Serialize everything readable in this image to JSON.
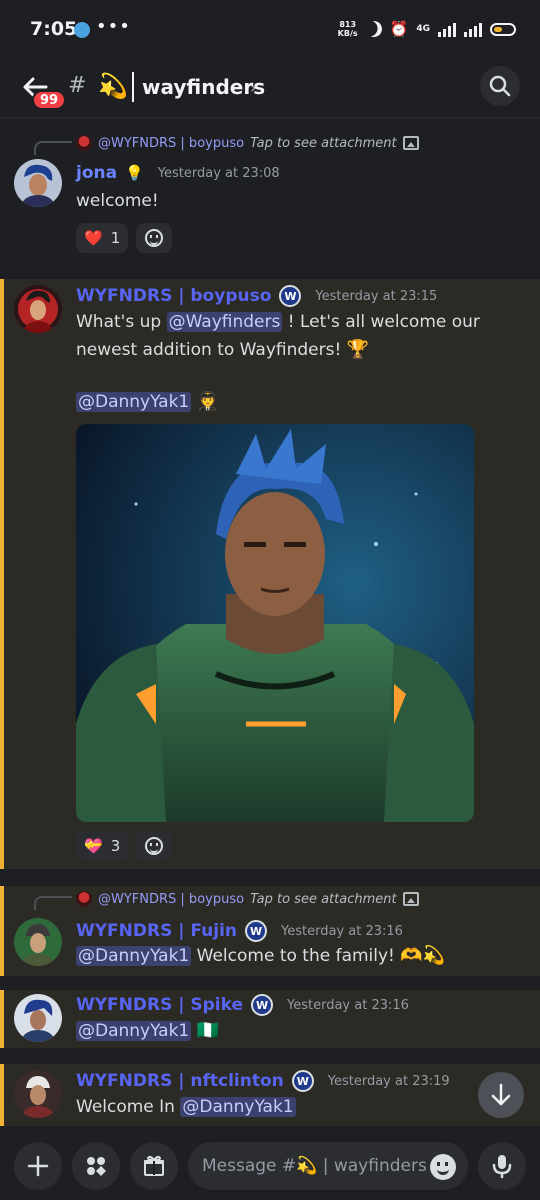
{
  "status_bar": {
    "time": "7:05",
    "dots": "•••",
    "speed_top": "813",
    "speed_bottom": "KB/s",
    "network": "4G"
  },
  "header": {
    "unread_count": "99",
    "hash": "#",
    "channel_emoji": "💫",
    "channel_name": "wayfinders",
    "chevron": "›"
  },
  "messages": [
    {
      "reply_name": "@WYFNDRS | boypuso",
      "reply_text": "Tap to see attachment",
      "author": "jona",
      "role_icon": "💡",
      "timestamp": "Yesterday at 23:08",
      "text": "welcome!",
      "reactions": [
        {
          "emoji": "❤️",
          "count": "1"
        }
      ]
    },
    {
      "author": "WYFNDRS | boypuso",
      "badge": "W",
      "timestamp": "Yesterday at 23:15",
      "text_before": "What's up ",
      "mention1": "@Wayfinders",
      "text_after": " ! Let's all welcome our newest addition to Wayfinders! ",
      "emoji1": "🏆",
      "mention2": "@DannyYak1",
      "emoji2": "🧑‍✈️",
      "reactions": [
        {
          "emoji": "💝",
          "count": "3"
        }
      ]
    },
    {
      "reply_name": "@WYFNDRS | boypuso",
      "reply_text": "Tap to see attachment",
      "author": "WYFNDRS | Fujin",
      "badge": "W",
      "timestamp": "Yesterday at 23:16",
      "mention": "@DannyYak1",
      "text": " Welcome to the family! ",
      "emoji": "🫶💫"
    },
    {
      "author": "WYFNDRS | Spike",
      "badge": "W",
      "timestamp": "Yesterday at 23:16",
      "mention": "@DannyYak1",
      "emoji": "🇳🇬"
    },
    {
      "author": "WYFNDRS | nftclinton",
      "badge": "W",
      "timestamp": "Yesterday at 23:19",
      "text": "Welcome In ",
      "mention": "@DannyYak1"
    }
  ],
  "composer": {
    "placeholder": "Message #💫 | wayfinders"
  },
  "colors": {
    "background": "#1e1f22",
    "highlight_bar": "#f0b232",
    "username": "#5865f2",
    "mention_bg": "#3c4270",
    "badge_red": "#f23f43"
  }
}
